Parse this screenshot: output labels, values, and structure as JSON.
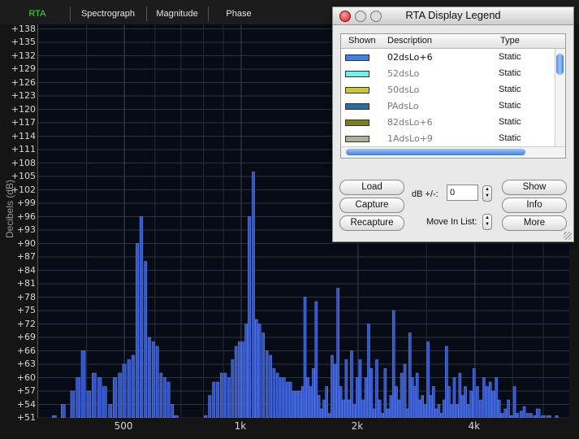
{
  "tabs": [
    "RTA",
    "Spectrograph",
    "Magnitude",
    "Phase"
  ],
  "active_tab": "RTA",
  "chart_data": {
    "type": "bar",
    "ylabel": "Decibels (dB)",
    "ylim": [
      51,
      139
    ],
    "y_ticks": [
      "+51",
      "+54",
      "+57",
      "+60",
      "+63",
      "+66",
      "+69",
      "+72",
      "+75",
      "+78",
      "+81",
      "+84",
      "+87",
      "+90",
      "+93",
      "+96",
      "+99",
      "+102",
      "+105",
      "+108",
      "+111",
      "+114",
      "+117",
      "+120",
      "+123",
      "+126",
      "+129",
      "+132",
      "+135",
      "+138"
    ],
    "x_ticks": [
      {
        "label": "500",
        "freq": 500
      },
      {
        "label": "1k",
        "freq": 1000
      },
      {
        "label": "2k",
        "freq": 2000
      },
      {
        "label": "4k",
        "freq": 4000
      }
    ],
    "xlim": [
      300,
      7000
    ],
    "series": [
      {
        "values": [
          [
            330,
            51.5
          ],
          [
            348,
            54
          ],
          [
            368,
            57
          ],
          [
            380,
            60
          ],
          [
            392,
            66
          ],
          [
            405,
            57
          ],
          [
            418,
            61
          ],
          [
            432,
            60
          ],
          [
            445,
            58
          ],
          [
            460,
            54
          ],
          [
            473,
            60
          ],
          [
            487,
            61
          ],
          [
            500,
            63
          ],
          [
            514,
            64
          ],
          [
            527,
            65
          ],
          [
            540,
            90
          ],
          [
            553,
            96
          ],
          [
            567,
            86
          ],
          [
            580,
            69
          ],
          [
            594,
            68
          ],
          [
            608,
            67
          ],
          [
            622,
            61
          ],
          [
            636,
            60
          ],
          [
            650,
            59
          ],
          [
            665,
            54
          ],
          [
            680,
            51.5
          ],
          [
            810,
            51.5
          ],
          [
            830,
            56
          ],
          [
            850,
            59
          ],
          [
            870,
            59
          ],
          [
            890,
            61
          ],
          [
            910,
            61
          ],
          [
            930,
            60
          ],
          [
            950,
            64
          ],
          [
            970,
            67
          ],
          [
            990,
            68
          ],
          [
            1010,
            68
          ],
          [
            1030,
            72
          ],
          [
            1050,
            96
          ],
          [
            1075,
            106
          ],
          [
            1095,
            73
          ],
          [
            1115,
            72
          ],
          [
            1140,
            70
          ],
          [
            1165,
            66
          ],
          [
            1190,
            65
          ],
          [
            1215,
            62
          ],
          [
            1240,
            61
          ],
          [
            1265,
            60
          ],
          [
            1290,
            60
          ],
          [
            1315,
            59
          ],
          [
            1340,
            59
          ],
          [
            1365,
            57
          ],
          [
            1390,
            57
          ],
          [
            1415,
            57
          ],
          [
            1440,
            58
          ],
          [
            1460,
            78
          ],
          [
            1485,
            60
          ],
          [
            1510,
            58
          ],
          [
            1535,
            62
          ],
          [
            1560,
            77
          ],
          [
            1585,
            56
          ],
          [
            1610,
            53
          ],
          [
            1635,
            55
          ],
          [
            1660,
            58
          ],
          [
            1690,
            52
          ],
          [
            1715,
            65
          ],
          [
            1745,
            63
          ],
          [
            1775,
            80
          ],
          [
            1805,
            58
          ],
          [
            1835,
            55
          ],
          [
            1865,
            64
          ],
          [
            1895,
            55
          ],
          [
            1925,
            66
          ],
          [
            1955,
            54
          ],
          [
            1990,
            60
          ],
          [
            2025,
            64
          ],
          [
            2060,
            55
          ],
          [
            2095,
            60
          ],
          [
            2130,
            72
          ],
          [
            2165,
            62
          ],
          [
            2200,
            53
          ],
          [
            2235,
            64
          ],
          [
            2275,
            55
          ],
          [
            2310,
            52
          ],
          [
            2350,
            62
          ],
          [
            2390,
            53
          ],
          [
            2430,
            56
          ],
          [
            2470,
            75
          ],
          [
            2510,
            58
          ],
          [
            2550,
            55
          ],
          [
            2590,
            61
          ],
          [
            2640,
            63
          ],
          [
            2680,
            53
          ],
          [
            2720,
            70
          ],
          [
            2760,
            60
          ],
          [
            2800,
            58
          ],
          [
            2840,
            61
          ],
          [
            2880,
            55
          ],
          [
            2930,
            56
          ],
          [
            2980,
            54
          ],
          [
            3030,
            68
          ],
          [
            3080,
            56
          ],
          [
            3130,
            58
          ],
          [
            3180,
            53
          ],
          [
            3230,
            54
          ],
          [
            3280,
            52
          ],
          [
            3330,
            55
          ],
          [
            3380,
            67
          ],
          [
            3430,
            58
          ],
          [
            3480,
            54
          ],
          [
            3540,
            60
          ],
          [
            3600,
            54
          ],
          [
            3660,
            61
          ],
          [
            3720,
            56
          ],
          [
            3780,
            58
          ],
          [
            3840,
            54
          ],
          [
            3910,
            57
          ],
          [
            3980,
            62
          ],
          [
            4060,
            58
          ],
          [
            4140,
            55
          ],
          [
            4220,
            60
          ],
          [
            4300,
            58
          ],
          [
            4380,
            59
          ],
          [
            4460,
            57
          ],
          [
            4540,
            60
          ],
          [
            4620,
            55
          ],
          [
            4700,
            52
          ],
          [
            4790,
            53
          ],
          [
            4880,
            55
          ],
          [
            4970,
            51.5
          ],
          [
            5060,
            58
          ],
          [
            5150,
            52
          ],
          [
            5260,
            52.5
          ],
          [
            5360,
            53.5
          ],
          [
            5470,
            52
          ],
          [
            5580,
            52
          ],
          [
            5700,
            51.5
          ],
          [
            5820,
            53
          ],
          [
            6000,
            51.5
          ],
          [
            6200,
            51.5
          ],
          [
            6500,
            51.5
          ]
        ]
      }
    ]
  },
  "legend_window": {
    "title": "RTA Display Legend",
    "columns": [
      "Shown",
      "Description",
      "Type"
    ],
    "rows": [
      {
        "desc": "02dsLo+6",
        "type": "Static",
        "color": "#3f7fe6",
        "dimmed": false
      },
      {
        "desc": "52dsLo",
        "type": "Static",
        "color": "#6ff0f0",
        "dimmed": true
      },
      {
        "desc": "50dsLo",
        "type": "Static",
        "color": "#c8c83a",
        "dimmed": true
      },
      {
        "desc": "PAdsLo",
        "type": "Static",
        "color": "#2a6ea0",
        "dimmed": true
      },
      {
        "desc": "82dsLo+6",
        "type": "Static",
        "color": "#7c7c20",
        "dimmed": true
      },
      {
        "desc": "1AdsLo+9",
        "type": "Static",
        "color": "#a9b39a",
        "dimmed": true
      }
    ],
    "buttons": {
      "load": "Load",
      "capture": "Capture",
      "recapture": "Recapture",
      "show": "Show",
      "info": "Info",
      "more": "More"
    },
    "db_label": "dB +/-:",
    "db_value": "0",
    "move_label": "Move In List:"
  }
}
